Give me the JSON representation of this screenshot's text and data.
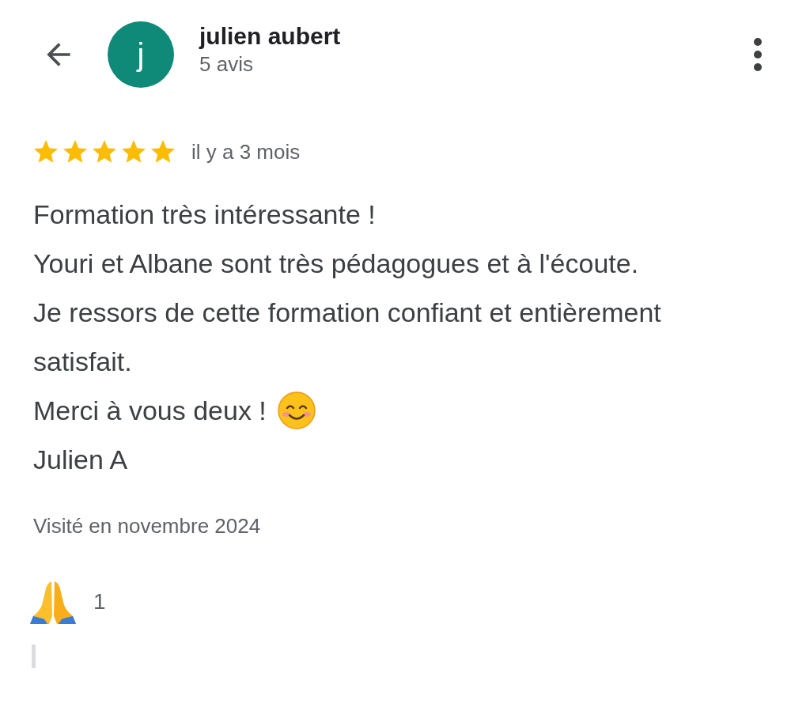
{
  "reviewer": {
    "avatar_letter": "j",
    "name": "julien aubert",
    "review_count": "5 avis"
  },
  "review": {
    "stars": 5,
    "time": "il y a 3 mois",
    "paragraphs": [
      {
        "text": "Formation très intéressante !"
      },
      {
        "text": "Youri et Albane sont très pédagogues et à l'écoute."
      },
      {
        "text": "Je ressors de cette formation confiant et entièrement satisfait."
      },
      {
        "text": "Merci à vous deux !",
        "kind": "smiley"
      },
      {
        "text": "Julien A"
      }
    ],
    "visited": "Visité en novembre 2024"
  },
  "reactions": [
    {
      "count": "1"
    }
  ]
}
